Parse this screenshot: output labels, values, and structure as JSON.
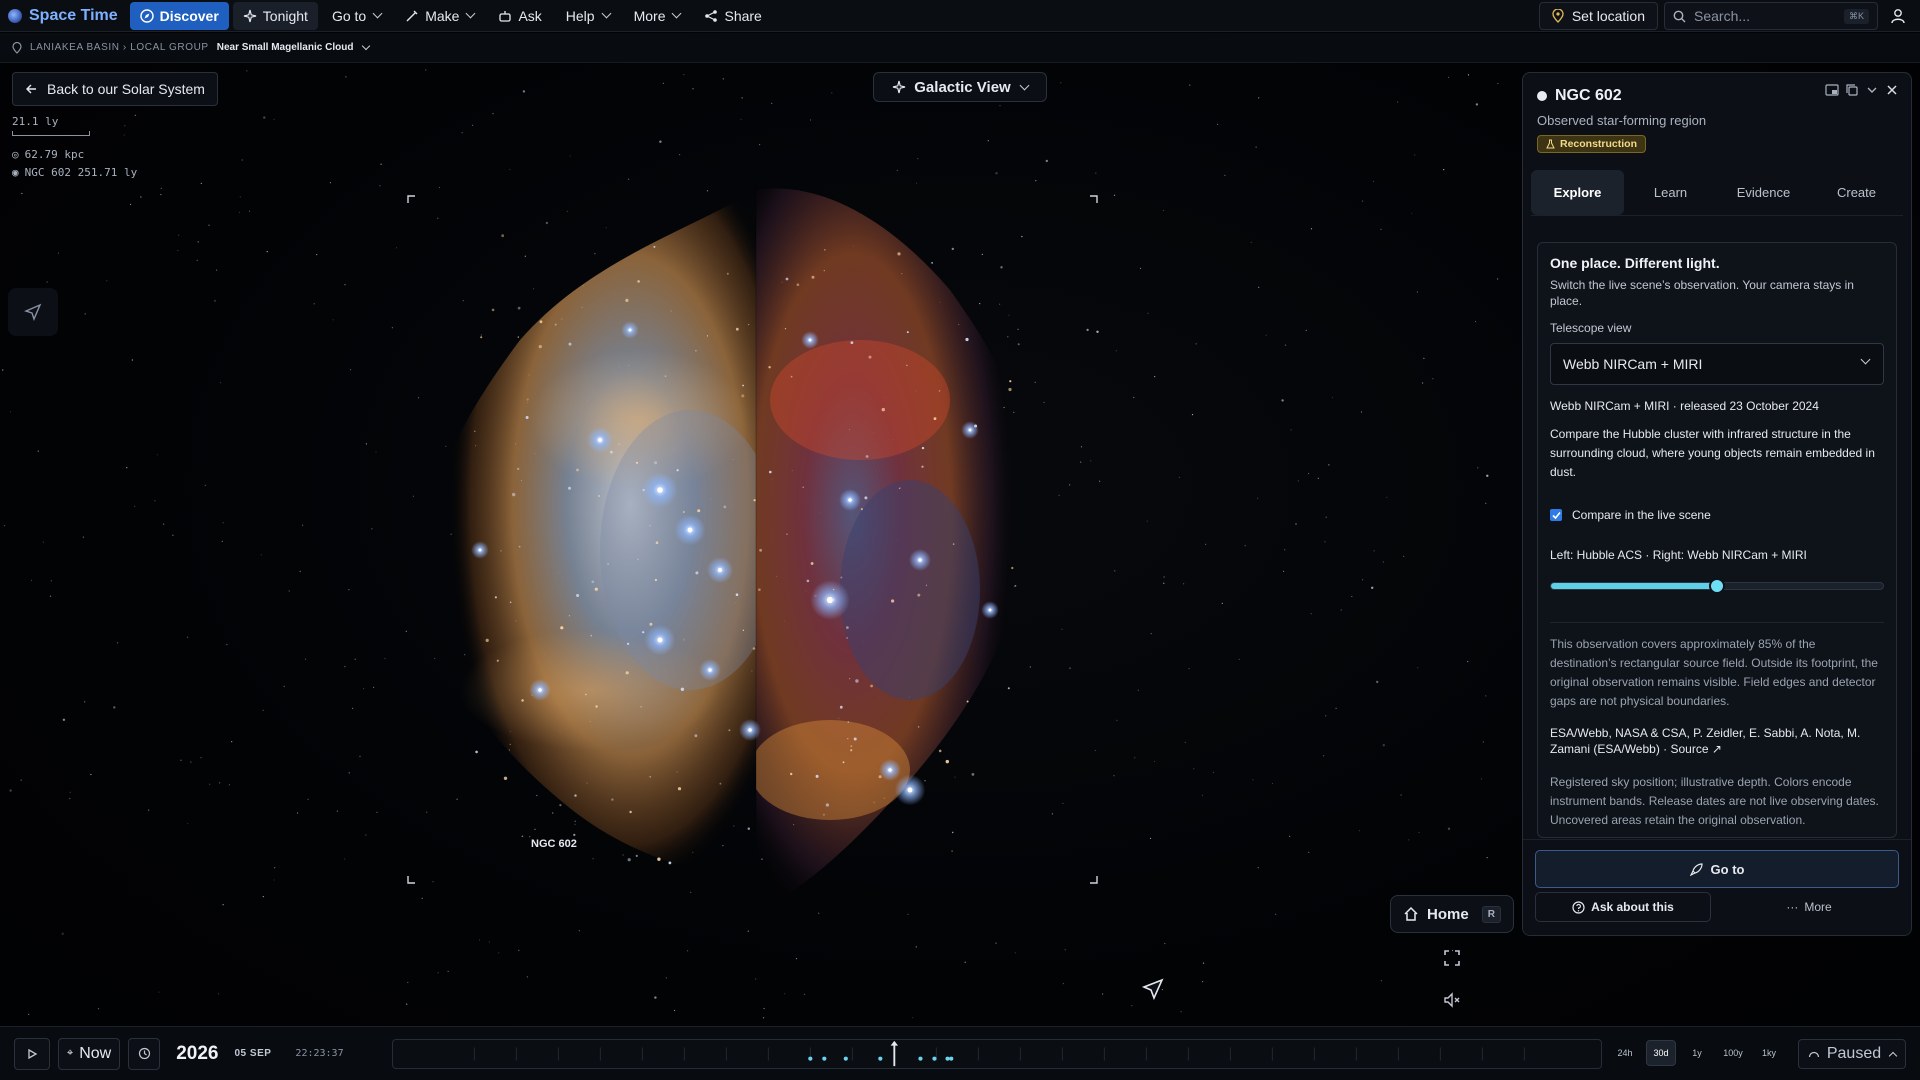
{
  "app": {
    "name": "Space Time"
  },
  "nav": {
    "discover": "Discover",
    "tonight": "Tonight",
    "goto": "Go to",
    "make": "Make",
    "ask": "Ask",
    "help": "Help",
    "more": "More",
    "share": "Share"
  },
  "topright": {
    "set_location": "Set location",
    "search_placeholder": "Search...",
    "search_shortcut": "⌘K"
  },
  "breadcrumb": {
    "path": "LANIAKEA BASIN › LOCAL GROUP",
    "current": "Near Small Magellanic Cloud"
  },
  "back_label": "Back to our Solar System",
  "scale": {
    "length": "21.1 ly",
    "distance1": "62.79 kpc",
    "distance2": "NGC 602 251.71 ly"
  },
  "view_mode": "Galactic View",
  "scene_label": "NGC 602",
  "panel": {
    "title": "NGC 602",
    "subtitle": "Observed star-forming region",
    "badge": "Reconstruction",
    "tabs": [
      "Explore",
      "Learn",
      "Evidence",
      "Create"
    ],
    "active_tab": "Explore",
    "card": {
      "heading": "One place. Different light.",
      "intro": "Switch the live scene’s observation. Your camera stays in place.",
      "telescope_label": "Telescope view",
      "telescope_value": "Webb NIRCam + MIRI",
      "release": "Webb NIRCam + MIRI · released 23 October 2024",
      "description": "Compare the Hubble cluster with infrared structure in the surrounding cloud, where young objects remain embedded in dust.",
      "compare_label": "Compare in the live scene",
      "compare_checked": true,
      "left_right": "Left: Hubble ACS · Right: Webb NIRCam + MIRI",
      "slider_value": 0.5,
      "coverage": "This observation covers approximately 85% of the destination’s rectangular source field. Outside its footprint, the original observation remains visible. Field edges and detector gaps are not physical boundaries.",
      "credit": "ESA/Webb, NASA & CSA, P. Zeidler, E. Sabbi, A. Nota, M. Zamani (ESA/Webb) · Source ↗",
      "note": "Registered sky position; illustrative depth. Colors encode instrument bands. Release dates are not live observing dates. Uncovered areas retain the original observation."
    },
    "actions": {
      "goto": "Go to",
      "ask": "Ask about this",
      "more": "More"
    }
  },
  "home": {
    "label": "Home",
    "shortcut": "R"
  },
  "timeline": {
    "now": "Now",
    "year": "2026",
    "date": "05 SEP",
    "time": "22:23:37",
    "zooms": [
      "24h",
      "30d",
      "1y",
      "100y",
      "1ky"
    ],
    "active_zoom": "30d",
    "status": "Paused"
  },
  "colors": {
    "accent": "#1f5fbf",
    "brand": "#7fb0ff",
    "badge": "#f3d98a",
    "slider": "#5fd1e6"
  }
}
